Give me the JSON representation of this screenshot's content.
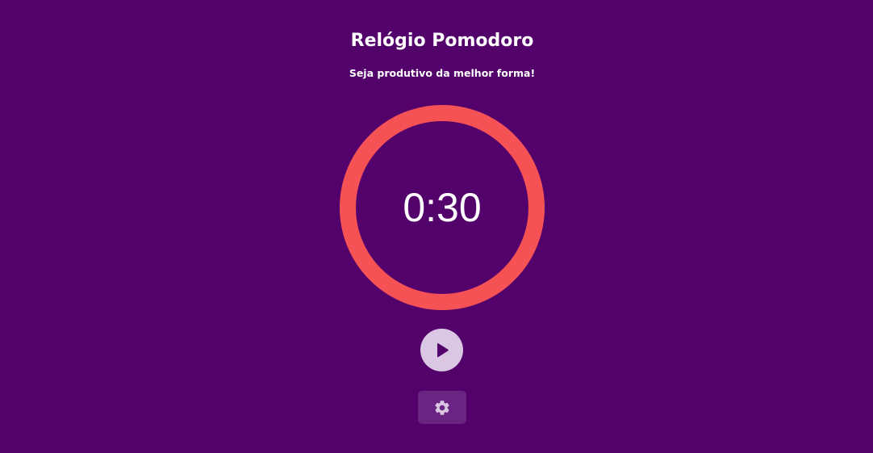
{
  "app": {
    "title": "Relógio Pomodoro",
    "subtitle": "Seja produtivo da melhor forma!"
  },
  "timer": {
    "display": "0:30",
    "progress": 1.0
  },
  "controls": {
    "play_icon": "play-icon",
    "settings_icon": "gear-icon"
  },
  "colors": {
    "background": "#53026b",
    "ring": "#f45254",
    "play_button_bg": "#dac7e3",
    "play_icon": "#53026b",
    "settings_button_bg": "#6a2583",
    "settings_icon": "#dac7e3",
    "text": "#ffffff"
  }
}
